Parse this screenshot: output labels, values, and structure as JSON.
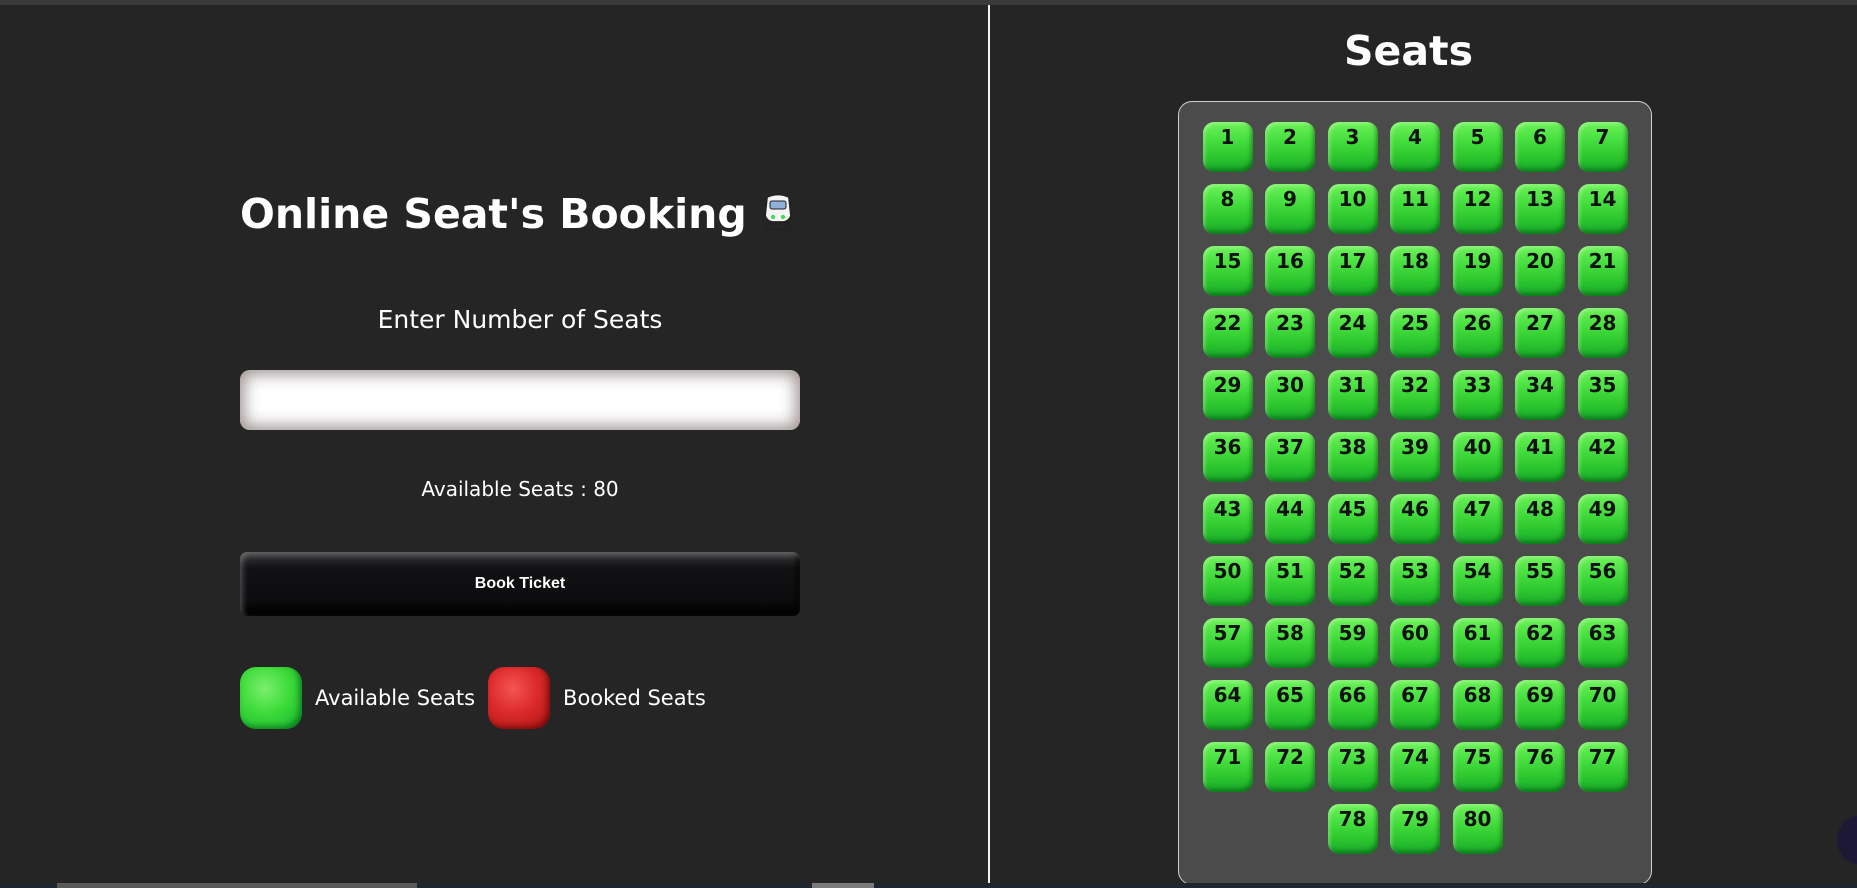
{
  "booking": {
    "title": "Online Seat's Booking",
    "title_icon": "ticket-icon",
    "prompt": "Enter Number of Seats",
    "input_value": "",
    "available_label": "Available Seats : 80",
    "book_button": "Book Ticket"
  },
  "legend": {
    "available": "Available Seats",
    "booked": "Booked Seats",
    "available_color": "#3edb3a",
    "booked_color": "#dc2a2a"
  },
  "seat_map": {
    "title": "Seats",
    "seats": [
      "1",
      "2",
      "3",
      "4",
      "5",
      "6",
      "7",
      "8",
      "9",
      "10",
      "11",
      "12",
      "13",
      "14",
      "15",
      "16",
      "17",
      "18",
      "19",
      "20",
      "21",
      "22",
      "23",
      "24",
      "25",
      "26",
      "27",
      "28",
      "29",
      "30",
      "31",
      "32",
      "33",
      "34",
      "35",
      "36",
      "37",
      "38",
      "39",
      "40",
      "41",
      "42",
      "43",
      "44",
      "45",
      "46",
      "47",
      "48",
      "49",
      "50",
      "51",
      "52",
      "53",
      "54",
      "55",
      "56",
      "57",
      "58",
      "59",
      "60",
      "61",
      "62",
      "63",
      "64",
      "65",
      "66",
      "67",
      "68",
      "69",
      "70",
      "71",
      "72",
      "73",
      "74",
      "75",
      "76",
      "77",
      "78",
      "79",
      "80"
    ]
  },
  "colors": {
    "background": "#252525",
    "panel": "#4b4b4b",
    "seat_available": "#3edb3a",
    "seat_booked": "#dc2a2a"
  }
}
